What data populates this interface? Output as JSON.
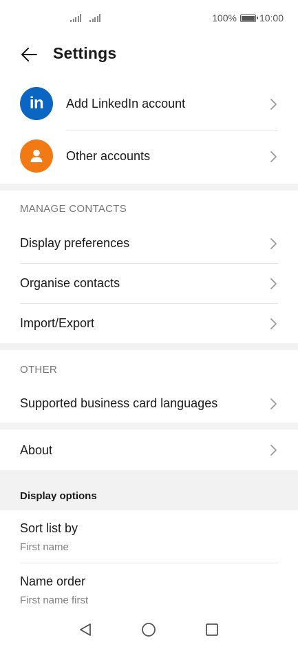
{
  "status_bar": {
    "battery": "100%",
    "time": "10:00",
    "signal_icons": [
      "signal-bars-icon",
      "signal-bars-icon"
    ]
  },
  "header": {
    "back_icon": "arrow-left-icon",
    "title": "Settings"
  },
  "accounts": [
    {
      "label": "Add LinkedIn account",
      "icon": "linkedin-icon",
      "color": "#0a66c2"
    },
    {
      "label": "Other accounts",
      "icon": "person-icon",
      "color": "#f27a14"
    }
  ],
  "manage_contacts": {
    "header": "MANAGE CONTACTS",
    "items": [
      "Display preferences",
      "Organise contacts",
      "Import/Export"
    ]
  },
  "other": {
    "header": "OTHER",
    "items": [
      "Supported business card languages"
    ]
  },
  "about": {
    "label": "About"
  },
  "display_options": {
    "title": "Display options",
    "items": [
      {
        "label": "Sort list by",
        "value": "First name"
      },
      {
        "label": "Name order",
        "value": "First name first"
      }
    ]
  },
  "nav_bar": {
    "icons": [
      "back-triangle-icon",
      "home-circle-icon",
      "recents-square-icon"
    ]
  }
}
